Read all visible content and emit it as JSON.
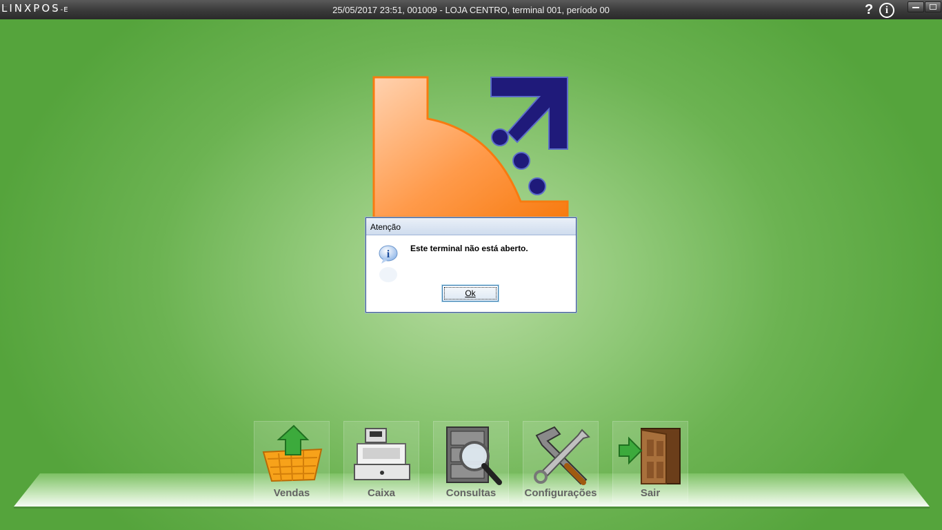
{
  "app": {
    "brand": "LINXPOS",
    "brand_suffix": "-E",
    "session_info": "25/05/2017 23:51, 001009 - LOJA CENTRO, terminal 001, período 00",
    "help_symbol": "?",
    "info_symbol": "i"
  },
  "dialog": {
    "title": "Atenção",
    "message": "Este terminal não está aberto.",
    "ok_label": "Ok",
    "icon": "information-icon"
  },
  "menu": [
    {
      "label": "Vendas",
      "icon": "shopping-basket-icon"
    },
    {
      "label": "Caixa",
      "icon": "cash-register-icon"
    },
    {
      "label": "Consultas",
      "icon": "file-cabinet-search-icon"
    },
    {
      "label": "Configurações",
      "icon": "tools-icon"
    },
    {
      "label": "Sair",
      "icon": "exit-door-icon"
    }
  ],
  "colors": {
    "logo_orange": "#f77b10",
    "logo_navy": "#1f1a7a",
    "background_green": "#6cb352"
  }
}
